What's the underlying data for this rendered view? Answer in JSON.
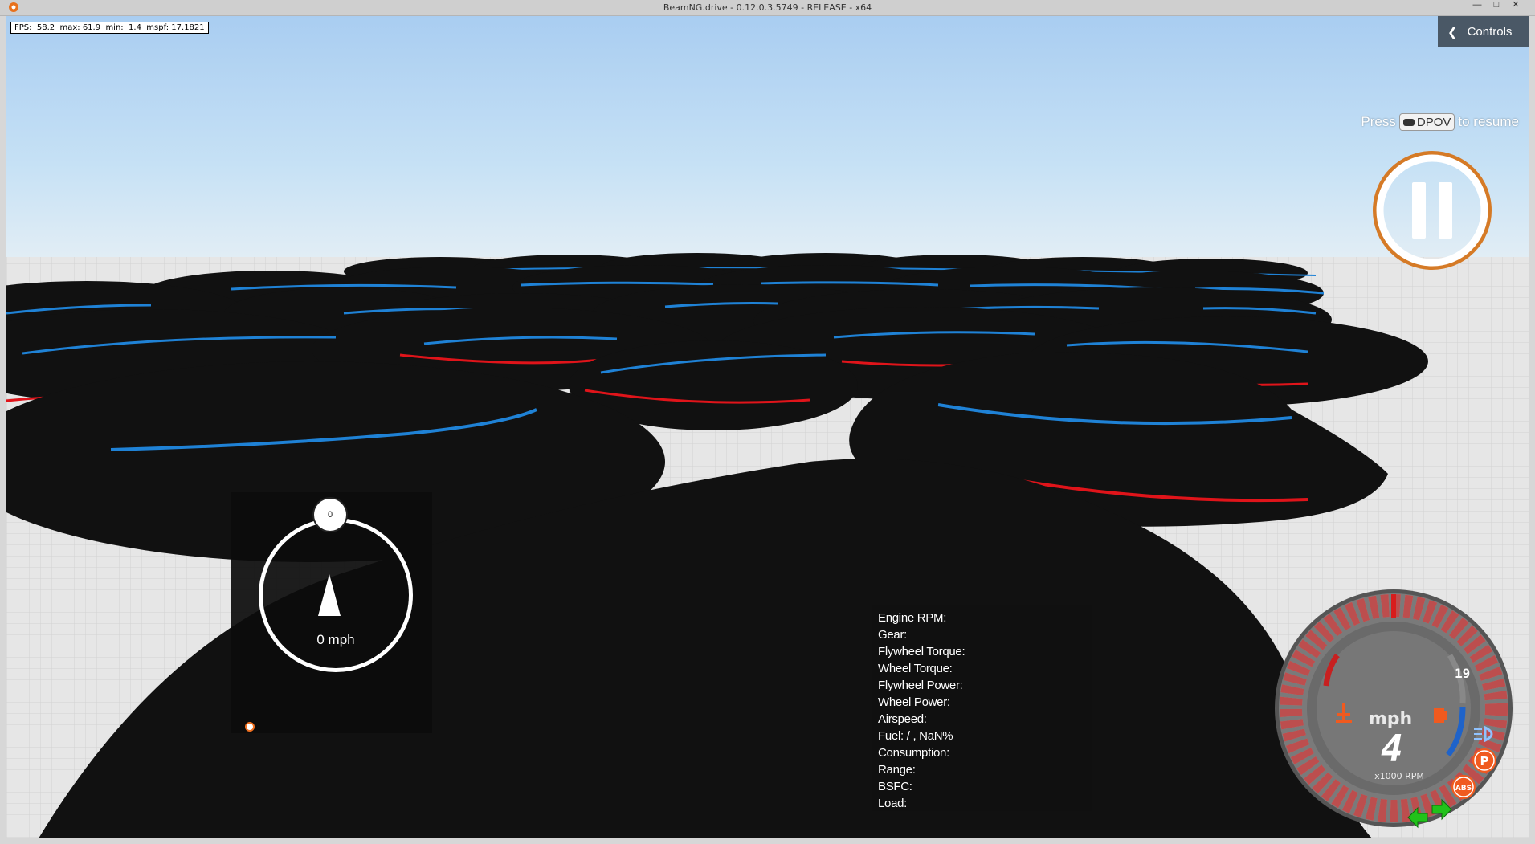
{
  "window": {
    "title": "BeamNG.drive - 0.12.0.3.5749 - RELEASE - x64",
    "buttons": {
      "minimize": "—",
      "maximize": "□",
      "close": "✕"
    }
  },
  "hud": {
    "fps_text": "FPS:  58.2  max: 61.9  min:  1.4  mspf: 17.1821",
    "controls_label": "Controls",
    "resume": {
      "prefix": "Press",
      "key": "DPOV",
      "suffix": "to resume"
    }
  },
  "navigation": {
    "heading": "0",
    "speed": "0 mph"
  },
  "engine_info": {
    "rows": [
      "Engine RPM:",
      "Gear:",
      "Flywheel Torque:",
      "Wheel Torque:",
      "Flywheel Power:",
      "Wheel Power:",
      "Airspeed:",
      "Fuel: / , NaN%",
      "Consumption:",
      "Range:",
      "BSFC:",
      "Load:"
    ]
  },
  "dashboard": {
    "unit": "mph",
    "speed": "4",
    "rpm_label": "x1000 RPM",
    "fuel_value": "19",
    "parking_badge": "P",
    "abs_badge": "ABS",
    "icons": [
      "seat-heater-icon",
      "fuel-pump-icon",
      "headlight-icon",
      "parking-brake-icon",
      "abs-icon",
      "left-turn-signal-icon",
      "right-turn-signal-icon"
    ],
    "colors": {
      "redline": "#d81c1c",
      "rpm_arc": "#c74a4a",
      "temp_arc": "#1f63c9",
      "turn_signal": "#21c21a",
      "warning": "#f05a1f"
    }
  },
  "scene_colors": {
    "disc": "#111111",
    "blue_line": "#1f82d6",
    "red_line": "#e0141a"
  }
}
